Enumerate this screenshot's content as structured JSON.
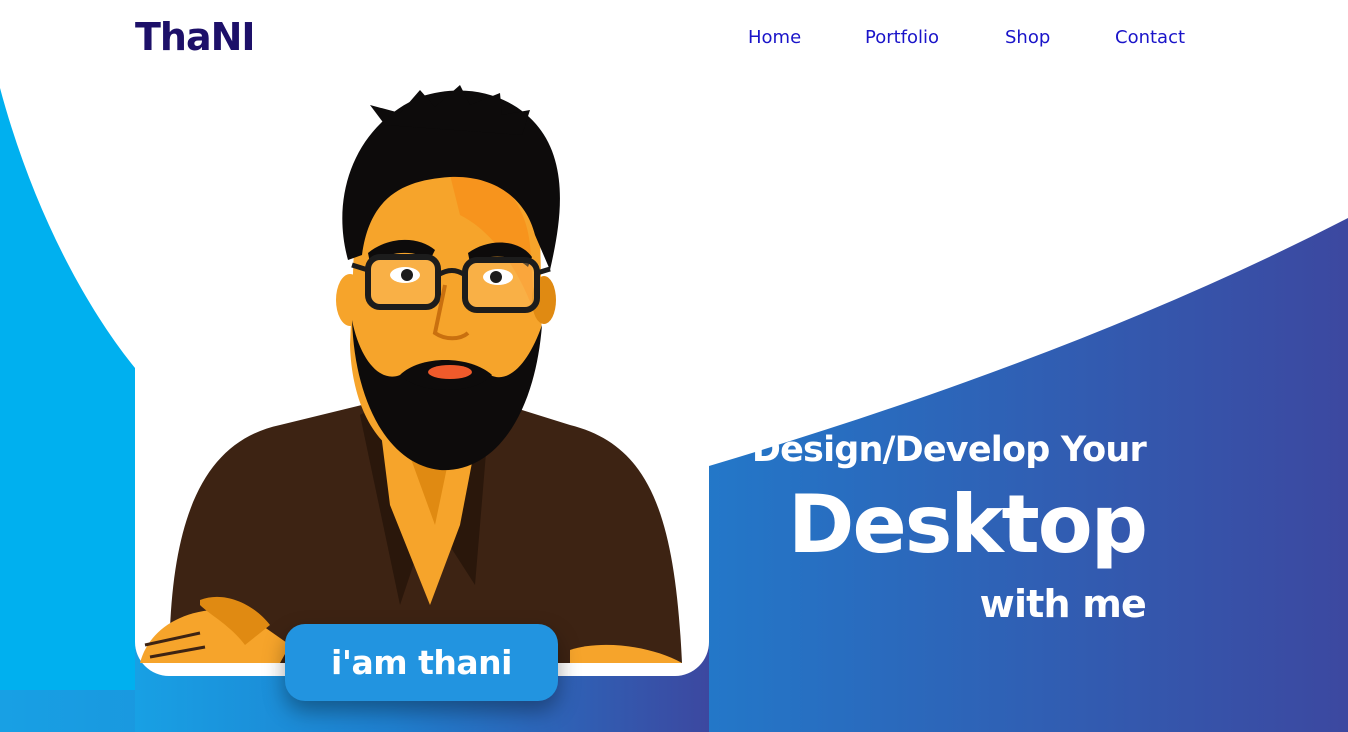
{
  "header": {
    "logo": "ThaNI",
    "nav": [
      {
        "label": "Home"
      },
      {
        "label": "Portfolio"
      },
      {
        "label": "Shop"
      },
      {
        "label": "Contact"
      }
    ]
  },
  "hero": {
    "line1": "Design/Develop Your",
    "line2": "Desktop",
    "line3": "with me",
    "button_label": "i'am thani"
  },
  "colors": {
    "logo": "#1d1069",
    "nav_link": "#1a14c9",
    "cyan_shape": "#00b0ef",
    "gradient_start": "#1d88d6",
    "gradient_end": "#3c4aa0",
    "button": "#2294e0"
  },
  "icons": {
    "portrait": "cartoon-portrait-illustration"
  }
}
